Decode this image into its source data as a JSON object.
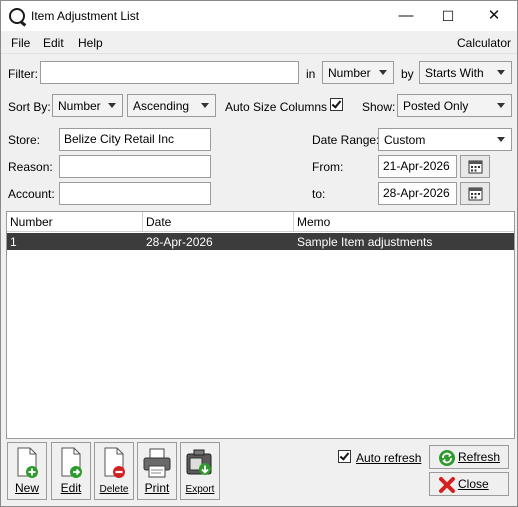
{
  "window": {
    "title": "Item Adjustment List",
    "minimize": "—",
    "maximize": "☐",
    "close": "✕"
  },
  "menu": {
    "file": "File",
    "edit": "Edit",
    "help": "Help",
    "calculator": "Calculator"
  },
  "filter": {
    "label": "Filter:",
    "value": "",
    "in_label": "in",
    "in_value": "Number",
    "by_label": "by",
    "by_value": "Starts With"
  },
  "sort": {
    "label": "Sort By:",
    "field": "Number",
    "order": "Ascending",
    "auto_size_label": "Auto Size Columns",
    "auto_size_checked": true,
    "show_label": "Show:",
    "show_value": "Posted Only"
  },
  "form": {
    "store_label": "Store:",
    "store_value": "Belize City Retail Inc",
    "reason_label": "Reason:",
    "reason_value": "",
    "account_label": "Account:",
    "account_value": "",
    "date_range_label": "Date Range:",
    "date_range_value": "Custom",
    "from_label": "From:",
    "from_value": "21-Apr-2026",
    "to_label": "to:",
    "to_value": "28-Apr-2026"
  },
  "table": {
    "columns": [
      "Number",
      "Date",
      "Memo"
    ],
    "rows": [
      {
        "number": "1",
        "date": "28-Apr-2026",
        "memo": "Sample Item adjustments"
      }
    ]
  },
  "toolbar": {
    "new": "New",
    "edit": "Edit",
    "delete": "Delete",
    "print": "Print",
    "export": "Export"
  },
  "bottom": {
    "auto_refresh_label": "Auto refresh",
    "auto_refresh_checked": true,
    "refresh": "Refresh",
    "close": "Close"
  },
  "colors": {
    "selection": "#3c3c3c",
    "window_bg": "#f0f0f0",
    "accent_green": "#2e9a2e",
    "accent_red": "#d32020"
  }
}
